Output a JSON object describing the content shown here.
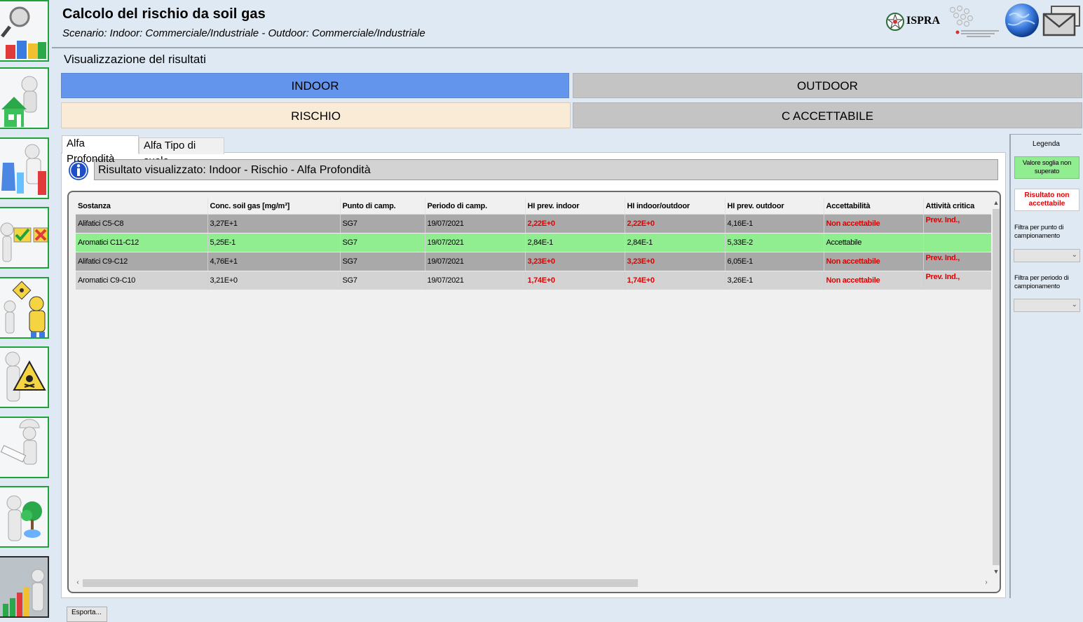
{
  "header": {
    "title": "Calcolo del rischio da soil gas",
    "scenario": "Scenario:  Indoor: Commerciale/Industriale -  Outdoor: Commerciale/Industriale",
    "logo_ispra": "ISPRA"
  },
  "section_label": "Visualizzazione del risultati",
  "toggles": {
    "indoor": "INDOOR",
    "outdoor": "OUTDOOR",
    "rischio": "RISCHIO",
    "c_accettabile": "C ACCETTABILE"
  },
  "tabs": [
    {
      "label": "Alfa Profondità",
      "active": true
    },
    {
      "label": "Alfa Tipo di suolo",
      "active": false
    }
  ],
  "info_text": "Risultato visualizzato: Indoor - Rischio - Alfa Profondità",
  "table": {
    "columns": [
      "Sostanza",
      "Conc. soil gas [mg/m³]",
      "Punto di camp.",
      "Periodo di camp.",
      "HI prev. indoor",
      "HI indoor/outdoor",
      "HI prev. outdoor",
      "Accettabilità",
      "Attività critica"
    ],
    "rows": [
      {
        "sostanza": "Alifatici C5-C8",
        "conc": "3,27E+1",
        "punto": "SG7",
        "periodo": "19/07/2021",
        "hi_indoor": "2,22E+0",
        "hi_in_out": "2,22E+0",
        "hi_outdoor": "4,16E-1",
        "accettabilita": "Non accettabile",
        "critica": "Prev. Ind.,"
      },
      {
        "sostanza": "Aromatici C11-C12",
        "conc": "5,25E-1",
        "punto": "SG7",
        "periodo": "19/07/2021",
        "hi_indoor": "2,84E-1",
        "hi_in_out": "2,84E-1",
        "hi_outdoor": "5,33E-2",
        "accettabilita": "Accettabile",
        "critica": ""
      },
      {
        "sostanza": "Alifatici C9-C12",
        "conc": "4,76E+1",
        "punto": "SG7",
        "periodo": "19/07/2021",
        "hi_indoor": "3,23E+0",
        "hi_in_out": "3,23E+0",
        "hi_outdoor": "6,05E-1",
        "accettabilita": "Non accettabile",
        "critica": "Prev. Ind.,"
      },
      {
        "sostanza": "Aromatici C9-C10",
        "conc": "3,21E+0",
        "punto": "SG7",
        "periodo": "19/07/2021",
        "hi_indoor": "1,74E+0",
        "hi_in_out": "1,74E+0",
        "hi_outdoor": "3,26E-1",
        "accettabilita": "Non accettabile",
        "critica": "Prev. Ind.,"
      }
    ]
  },
  "legend": {
    "title": "Legenda",
    "ok_label": "Valore soglia non superato",
    "ko_label": "Risultato non accettabile",
    "filter_punto_label": "Filtra per punto di campionamento",
    "filter_punto_value": "",
    "filter_periodo_label": "Filtra per periodo di campionamento",
    "filter_periodo_value": ""
  },
  "export_label": "Esporta...",
  "colors": {
    "indoor_active": "#6495ed",
    "rischio_active": "#faebd7",
    "inactive": "#c4c4c4",
    "row_exceeded": "#a9a9a9",
    "row_ok": "#90ee90",
    "row_exceeded_alt": "#d3d3d3",
    "alert_text": "#e00000",
    "rail_border": "#1ea23a"
  },
  "rail_icons": [
    "search-report-icon",
    "home-settings-icon",
    "laboratory-icon",
    "approve-reject-icon",
    "hazmat-worker-icon",
    "toxic-warning-icon",
    "engineer-ruler-icon",
    "ecology-plant-icon",
    "results-chart-icon"
  ]
}
